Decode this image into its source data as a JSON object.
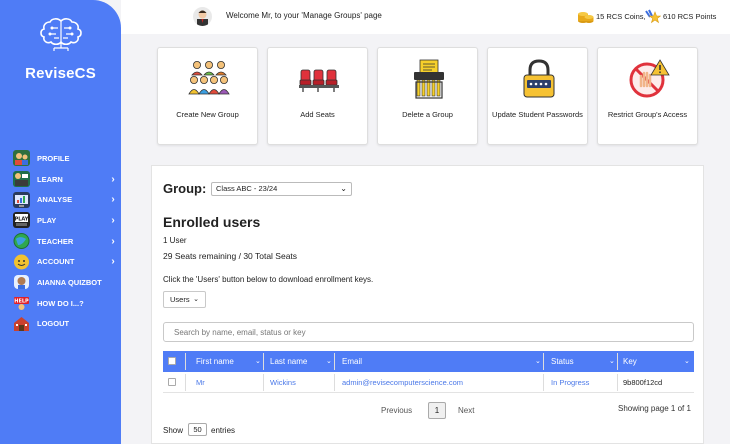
{
  "brand": "ReviseCS",
  "sidebar": {
    "items": [
      {
        "label": "PROFILE",
        "icon": "profile-icon",
        "chevron": ""
      },
      {
        "label": "LEARN",
        "icon": "learn-icon",
        "chevron": "›"
      },
      {
        "label": "ANALYSE",
        "icon": "analyse-icon",
        "chevron": "›"
      },
      {
        "label": "PLAY",
        "icon": "play-icon",
        "chevron": "›"
      },
      {
        "label": "TEACHER",
        "icon": "teacher-icon",
        "chevron": "›"
      },
      {
        "label": "ACCOUNT",
        "icon": "account-icon",
        "chevron": "›"
      },
      {
        "label": "AIANNA QUIZBOT",
        "icon": "quizbot-icon",
        "chevron": ""
      },
      {
        "label": "HOW DO I...?",
        "icon": "help-icon",
        "chevron": ""
      },
      {
        "label": "LOGOUT",
        "icon": "logout-icon",
        "chevron": ""
      }
    ]
  },
  "header": {
    "welcome": "Welcome Mr, to your 'Manage Groups' page",
    "coins": "15 RCS Coins,",
    "points": "610 RCS Points"
  },
  "cards": [
    {
      "label": "Create New Group",
      "icon": "people-group-icon"
    },
    {
      "label": "Add Seats",
      "icon": "seats-icon"
    },
    {
      "label": "Delete a Group",
      "icon": "shredder-icon"
    },
    {
      "label": "Update Student Passwords",
      "icon": "padlock-icon"
    },
    {
      "label": "Restrict Group's Access",
      "icon": "restricted-icon"
    }
  ],
  "group": {
    "label": "Group:",
    "selected": "Class ABC - 23/24"
  },
  "enrolled": {
    "title": "Enrolled users",
    "count": "1 User",
    "seats": "29 Seats remaining / 30 Total Seats",
    "info": "Click the 'Users' button below to download enrollment keys.",
    "users_button": "Users"
  },
  "search": {
    "placeholder": "Search by name, email, status or key"
  },
  "table": {
    "headers": [
      "First name",
      "Last name",
      "Email",
      "Status",
      "Key"
    ],
    "rows": [
      {
        "first": "Mr",
        "last": "Wickins",
        "email": "admin@revisecomputerscience.com",
        "status": "In Progress",
        "key": "9b800f12cd"
      }
    ]
  },
  "pagination": {
    "prev": "Previous",
    "page": "1",
    "next": "Next",
    "showing": "Showing page 1 of 1",
    "show_label": "Show",
    "show_value": "50",
    "entries_label": "entries"
  },
  "colors": {
    "accent": "#4f7cf6",
    "link": "#4a78e8"
  }
}
